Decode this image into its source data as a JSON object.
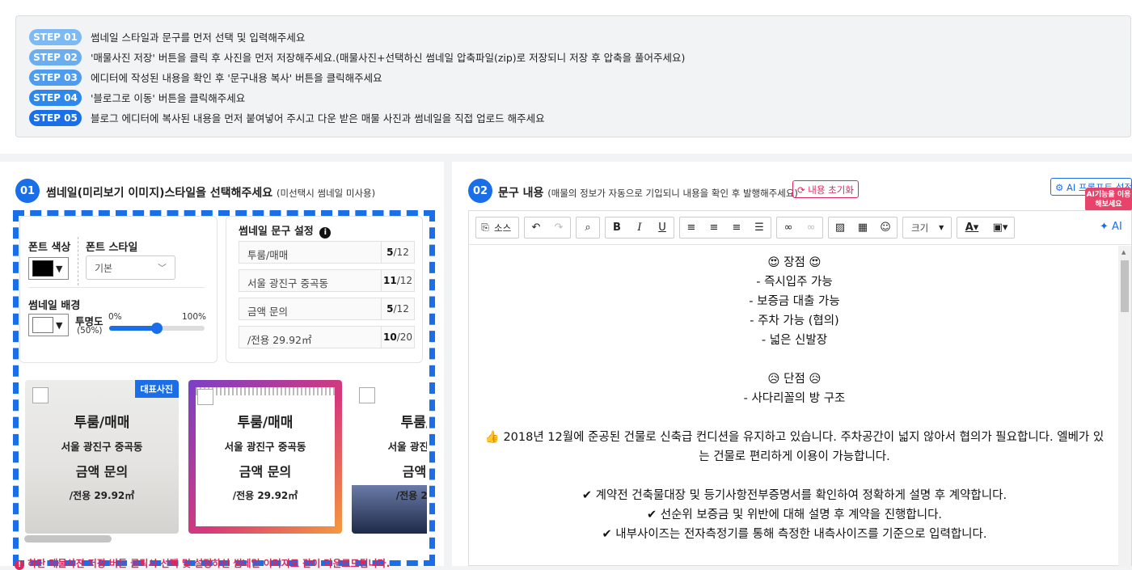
{
  "steps": [
    {
      "badge": "STEP 01",
      "color": "#7db9f2",
      "text": "썸네일 스타일과 문구를 먼저 선택 및 입력해주세요"
    },
    {
      "badge": "STEP 02",
      "color": "#6aaef0",
      "text": "'매물사진 저장' 버튼을 클릭 후 사진을 먼저 저장해주세요.(매물사진+선택하신 썸네일 압축파일(zip)로 저장되니 저장 후 압축을 풀어주세요)"
    },
    {
      "badge": "STEP 03",
      "color": "#4d9cef",
      "text": "에디터에 작성된 내용을 확인 후 '문구내용 복사' 버튼을 클릭해주세요"
    },
    {
      "badge": "STEP 04",
      "color": "#2d88ee",
      "text": "'블로그로 이동' 버튼을 클릭해주세요"
    },
    {
      "badge": "STEP 05",
      "color": "#1a6fe8",
      "text": "블로그 에디터에 복사된 내용을 먼저 붙여넣어 주시고 다운 받은 매물 사진과 썸네일을 직접 업로드 해주세요"
    }
  ],
  "left": {
    "num": "01",
    "title": "썸네일(미리보기 이미지)스타일을 선택해주세요",
    "subtitle": "(미선택시 썸네일 미사용)",
    "font_color_label": "폰트 색상",
    "font_style_label": "폰트 스타일",
    "font_style_value": "기본",
    "bg_label": "썸네일 배경",
    "opacity_label": "투명도",
    "opacity_value": "(50%)",
    "opacity_level": 0.5,
    "slider_min": "0%",
    "slider_max": "100%",
    "text_settings_label": "썸네일 문구 설정",
    "text_rows": [
      {
        "value": "투룸/매매",
        "count": "5",
        "max": "/12"
      },
      {
        "value": "서울 광진구 중곡동",
        "count": "11",
        "max": "/12"
      },
      {
        "value": "금액 문의",
        "count": "5",
        "max": "/12"
      },
      {
        "value": "/전용 29.92㎡",
        "count": "10",
        "max": "/20"
      }
    ],
    "thumb_texts": {
      "t1": "투룸/매매",
      "t2": "서울 광진구 중곡동",
      "t3": "금액 문의",
      "t4": "/전용 29.92㎡"
    },
    "rep_badge": "대표사진",
    "warning": "하단 매물사진 저장 버튼 클릭시 선택 및 설정하신 썸네일 이미지도 같이 다운로드됩니다."
  },
  "right": {
    "num": "02",
    "title": "문구 내용",
    "subtitle": "(매물의 정보가 자동으로 기입되니 내용을 확인 후 발행해주세요)",
    "reset_label": "내용 초기화",
    "ai_settings_label": "AI 프롬프트 설정",
    "ai_tip": "AI기능을 이용해보세요",
    "toolbar": {
      "source": "소스",
      "size": "크기",
      "ai": "AI"
    },
    "content": [
      "😍 장점 😍",
      "- 즉시입주 가능",
      "- 보증금 대출 가능",
      "- 주차 가능 (협의)",
      "- 넓은 신발장",
      "",
      "😥 단점 😥",
      "- 사다리꼴의 방 구조",
      "",
      "👍 2018년 12월에 준공된 건물로 신축급 컨디션을 유지하고 있습니다. 주차공간이 넓지 않아서 협의가 필요합니다. 엘베가 있는 건물로 편리하게 이용이 가능합니다.",
      "",
      "✔ 계약전 건축물대장 및 등기사항전부증명서를 확인하여 정확하게 설명 후 계약합니다.",
      "✔ 선순위 보증금 및 위반에 대해 설명 후 계약을 진행합니다.",
      "✔ 내부사이즈는 전자측정기를 통해 측정한 내측사이즈를 기준으로 입력합니다."
    ]
  }
}
